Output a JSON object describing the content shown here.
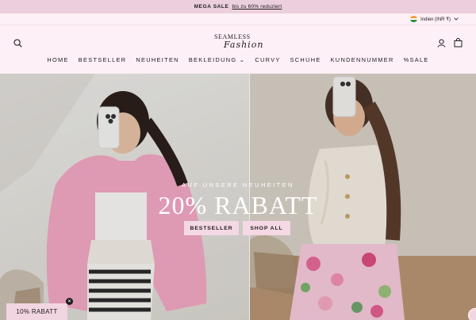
{
  "announcement": {
    "bold": "MEGA SALE",
    "link": "bis zu 60% reduziert"
  },
  "locale": {
    "label": "Indien (INR ₹)"
  },
  "brand": {
    "top": "SEAMLESS",
    "script": "Fashion"
  },
  "nav": {
    "items": [
      {
        "label": "HOME"
      },
      {
        "label": "BESTSELLER"
      },
      {
        "label": "NEUHEITEN"
      },
      {
        "label": "BEKLEIDUNG ⌄"
      },
      {
        "label": "CURVY"
      },
      {
        "label": "SCHUHE"
      },
      {
        "label": "KUNDENNUMMER"
      },
      {
        "label": "%SALE"
      }
    ]
  },
  "hero": {
    "eyebrow": "AUF UNSERE NEUHEITEN",
    "headline": "20% RABATT",
    "cta_primary": "BESTSELLER",
    "cta_secondary": "SHOP ALL"
  },
  "promo": {
    "label": "10% RABATT",
    "close": "✕"
  },
  "icons": {
    "search": "search-icon",
    "account": "user-icon",
    "cart": "bag-icon",
    "chevron": "chevron-down-icon"
  },
  "colors": {
    "announcement_bg": "#eccfdd",
    "header_bg": "#fdf0f6",
    "button_bg": "#f4d8e4",
    "text": "#1c1c1c"
  }
}
